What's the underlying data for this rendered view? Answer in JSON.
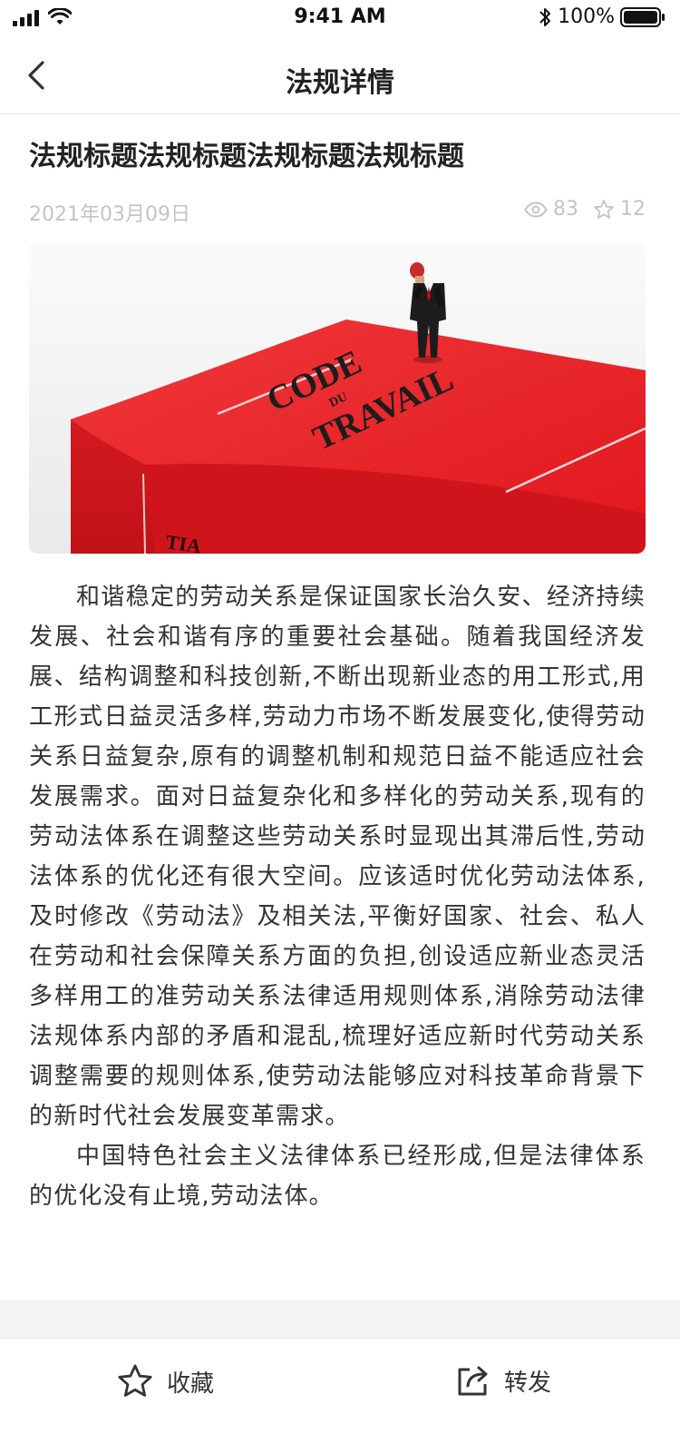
{
  "status_bar": {
    "time": "9:41 AM",
    "battery": "100%"
  },
  "nav": {
    "title": "法规详情"
  },
  "article": {
    "title": "法规标题法规标题法规标题法规标题",
    "date": "2021年03月09日",
    "views": "83",
    "favorites": "12",
    "image_text": [
      "CODE",
      "DU",
      "TRAVAIL"
    ],
    "paragraphs": [
      "和谐稳定的劳动关系是保证国家长治久安、经济持续发展、社会和谐有序的重要社会基础。随着我国经济发展、结构调整和科技创新,不断出现新业态的用工形式,用工形式日益灵活多样,劳动力市场不断发展变化,使得劳动关系日益复杂,原有的调整机制和规范日益不能适应社会发展需求。面对日益复杂化和多样化的劳动关系,现有的劳动法体系在调整这些劳动关系时显现出其滞后性,劳动法体系的优化还有很大空间。应该适时优化劳动法体系,及时修改《劳动法》及相关法,平衡好国家、社会、私人在劳动和社会保障关系方面的负担,创设适应新业态灵活多样用工的准劳动关系法律适用规则体系,消除劳动法律法规体系内部的矛盾和混乱,梳理好适应新时代劳动关系调整需要的规则体系,使劳动法能够应对科技革命背景下的新时代社会发展变革需求。",
      "中国特色社会主义法律体系已经形成,但是法律体系的优化没有止境,劳动法体。"
    ]
  },
  "bottom_bar": {
    "favorite_label": "收藏",
    "share_label": "转发"
  },
  "icons": {
    "back": "chevron-left-icon",
    "views": "eye-icon",
    "favorites": "star-outline-icon",
    "share": "share-icon"
  },
  "colors": {
    "meta_gray": "#c4c4c4",
    "book_red": "#e8242a",
    "band_gray": "#f5f5f5"
  }
}
